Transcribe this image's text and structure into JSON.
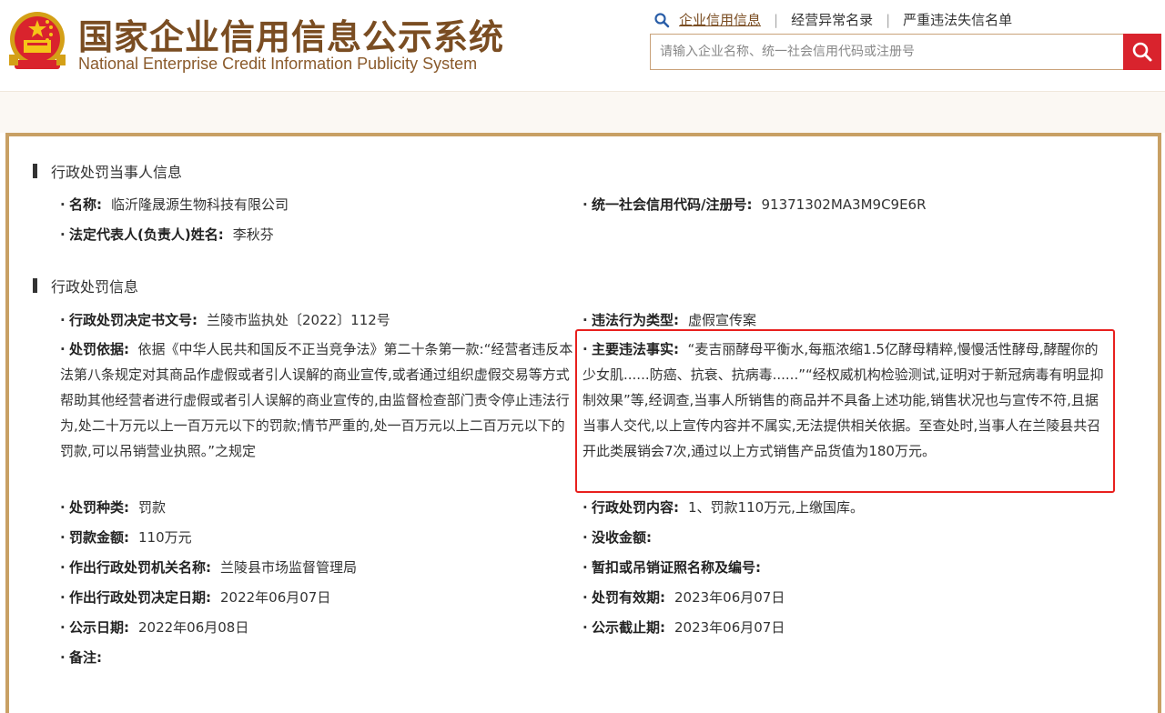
{
  "header": {
    "title_cn": "国家企业信用信息公示系统",
    "title_en": "National Enterprise Credit Information Publicity System",
    "links": [
      "企业信用信息",
      "经营异常名录",
      "严重违法失信名单"
    ],
    "search_placeholder": "请输入企业名称、统一社会信用代码或注册号",
    "icons": {
      "search": "search-icon",
      "magnifier": "magnifier-icon",
      "emblem": "national-emblem-icon"
    },
    "colors": {
      "brand": "#7a4d22",
      "search_button": "#d9232d",
      "frame": "#c8a064",
      "highlight": "#e8201e"
    }
  },
  "party": {
    "section_title": "行政处罚当事人信息",
    "name_label": "名称:",
    "name": "临沂隆晟源生物科技有限公司",
    "credit_code_label": "统一社会信用代码/注册号:",
    "credit_code": "91371302MA3M9C9E6R",
    "legal_rep_label": "法定代表人(负责人)姓名:",
    "legal_rep": "李秋芬"
  },
  "penalty": {
    "section_title": "行政处罚信息",
    "doc_no_label": "行政处罚决定书文号:",
    "doc_no": "兰陵市监执处〔2022〕112号",
    "violation_type_label": "违法行为类型:",
    "violation_type": "虚假宣传案",
    "basis_label": "处罚依据:",
    "basis": "依据《中华人民共和国反不正当竞争法》第二十条第一款:“经营者违反本法第八条规定对其商品作虚假或者引人误解的商业宣传,或者通过组织虚假交易等方式帮助其他经营者进行虚假或者引人误解的商业宣传的,由监督检查部门责令停止违法行为,处二十万元以上一百万元以下的罚款;情节严重的,处一百万元以上二百万元以下的罚款,可以吊销营业执照。”之规定",
    "facts_label": "主要违法事实:",
    "facts": "“麦吉丽酵母平衡水,每瓶浓缩1.5亿酵母精粹,慢慢活性酵母,酵醒你的少女肌......防癌、抗衰、抗病毒......”“经权威机构检验测试,证明对于新冠病毒有明显抑制效果”等,经调查,当事人所销售的商品并不具备上述功能,销售状况也与宣传不符,且据当事人交代,以上宣传内容并不属实,无法提供相关依据。至查处时,当事人在兰陵县共召开此类展销会7次,通过以上方式销售产品货值为180万元。",
    "kind_label": "处罚种类:",
    "kind": "罚款",
    "content_label": "行政处罚内容:",
    "content": "1、罚款110万元,上缴国库。",
    "fine_label": "罚款金额:",
    "fine": "110万元",
    "confiscation_label": "没收金额:",
    "confiscation": "",
    "authority_label": "作出行政处罚机关名称:",
    "authority": "兰陵县市场监督管理局",
    "license_label": "暂扣或吊销证照名称及编号:",
    "license": "",
    "decision_date_label": "作出行政处罚决定日期:",
    "decision_date": "2022年06月07日",
    "validity_label": "处罚有效期:",
    "validity": "2023年06月07日",
    "publish_date_label": "公示日期:",
    "publish_date": "2022年06月08日",
    "publish_end_label": "公示截止期:",
    "publish_end": "2023年06月07日",
    "remark_label": "备注:",
    "remark": ""
  }
}
